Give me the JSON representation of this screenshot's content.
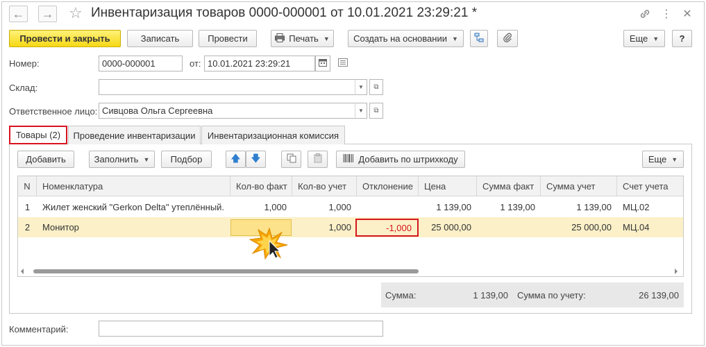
{
  "window": {
    "title": "Инвентаризация товаров 0000-000001 от 10.01.2021 23:29:21 *",
    "back_icon": "←",
    "forward_icon": "→",
    "star_icon": "☆",
    "link_icon": "🔗",
    "more_icon": "⋮",
    "close_icon": "✕"
  },
  "toolbar": {
    "post_and_close": "Провести и закрыть",
    "save": "Записать",
    "post": "Провести",
    "print": "Печать",
    "create_based_on": "Создать на основании",
    "more": "Еще",
    "help": "?"
  },
  "header": {
    "number_label": "Номер:",
    "number_value": "0000-000001",
    "date_label": "от:",
    "date_value": "10.01.2021 23:29:21",
    "warehouse_label": "Склад:",
    "warehouse_value": "",
    "responsible_label": "Ответственное лицо:",
    "responsible_value": "Сивцова Ольга Сергеевна"
  },
  "tabs": [
    {
      "label": "Товары (2)",
      "active": true
    },
    {
      "label": "Проведение инвентаризации",
      "active": false
    },
    {
      "label": "Инвентаризационная комиссия",
      "active": false
    }
  ],
  "table_toolbar": {
    "add": "Добавить",
    "fill": "Заполнить",
    "select": "Подбор",
    "add_by_barcode": "Добавить по штрихкоду",
    "more": "Еще"
  },
  "table": {
    "columns": [
      "N",
      "Номенклатура",
      "Кол-во факт",
      "Кол-во учет",
      "Отклонение",
      "Цена",
      "Сумма факт",
      "Сумма учет",
      "Счет учета"
    ],
    "rows": [
      {
        "n": "1",
        "item": "Жилет женский \"Gerkon Delta\" утеплённый.",
        "qty_fact": "1,000",
        "qty_account": "1,000",
        "deviation": "",
        "price": "1 139,00",
        "sum_fact": "1 139,00",
        "sum_account": "1 139,00",
        "account": "МЦ.02"
      },
      {
        "n": "2",
        "item": "Монитор",
        "qty_fact": "",
        "qty_account": "1,000",
        "deviation": "-1,000",
        "price": "25 000,00",
        "sum_fact": "",
        "sum_account": "25 000,00",
        "account": "МЦ.04"
      }
    ]
  },
  "totals": {
    "sum_label": "Сумма:",
    "sum_value": "1 139,00",
    "account_sum_label": "Сумма по учету:",
    "account_sum_value": "26 139,00"
  },
  "footer": {
    "comment_label": "Комментарий:",
    "comment_value": ""
  },
  "colors": {
    "accent_yellow": "#f6d816",
    "highlight_red": "#d7141f",
    "selected_row": "#fbf0c8"
  }
}
